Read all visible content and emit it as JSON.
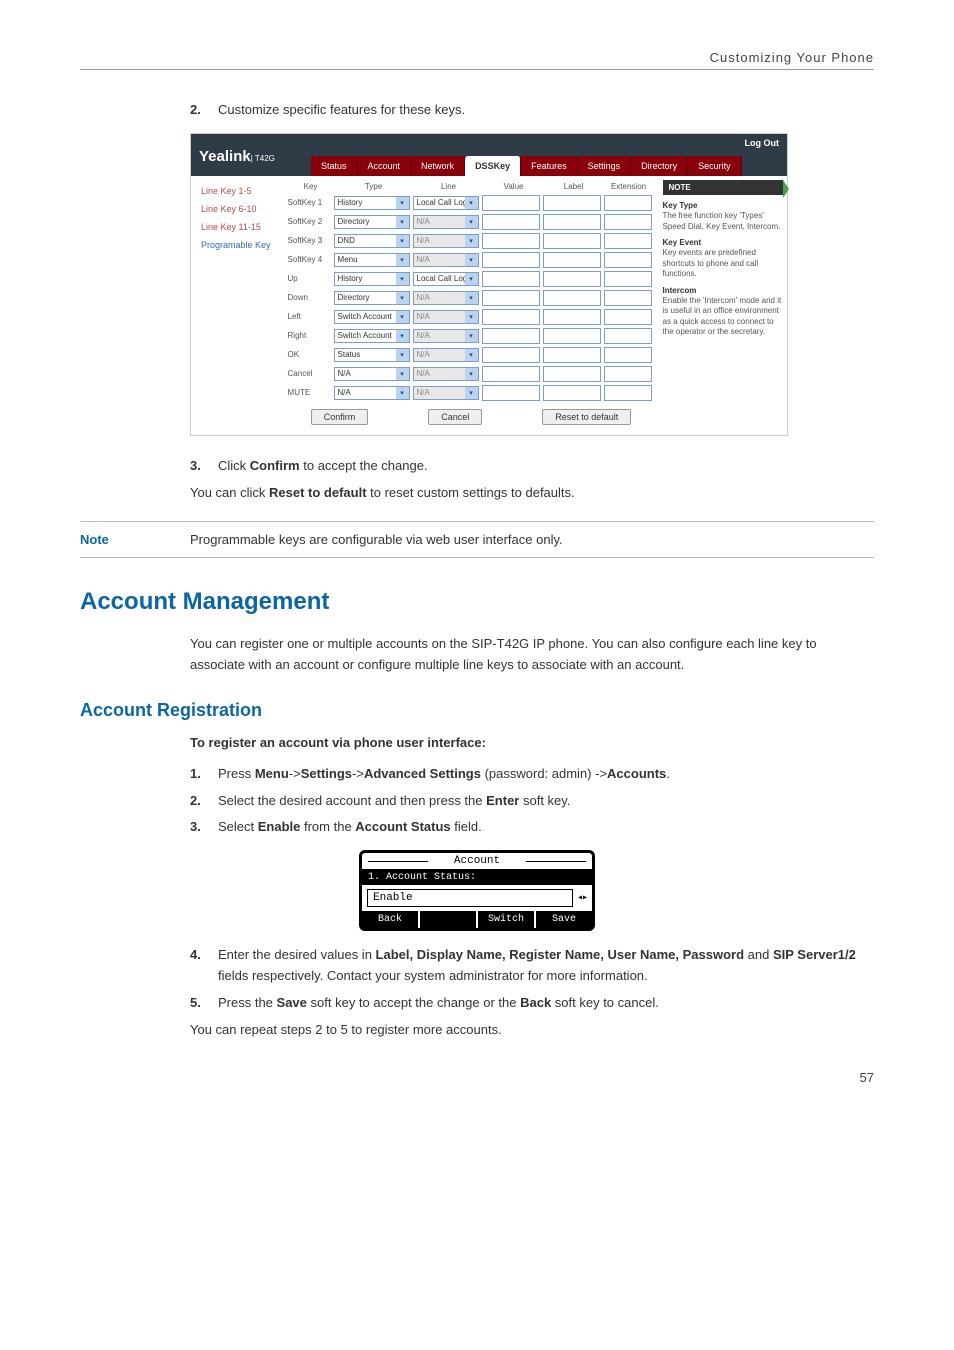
{
  "header": "Customizing Your Phone",
  "step2": {
    "num": "2.",
    "text": "Customize specific features for these keys."
  },
  "webui": {
    "logout": "Log Out",
    "brand": "Yealink",
    "brand_sub": "| T42G",
    "tabs": [
      "Status",
      "Account",
      "Network",
      "DSSKey",
      "Features",
      "Settings",
      "Directory",
      "Security"
    ],
    "active_tab": "DSSKey",
    "side": [
      "Line Key 1-5",
      "Line Key 6-10",
      "Line Key 11-15",
      "Programable Key"
    ],
    "side_active": "Programable Key",
    "cols": [
      "Key",
      "Type",
      "Line",
      "Value",
      "Label",
      "Extension"
    ],
    "rows": [
      {
        "key": "SoftKey 1",
        "type": "History",
        "line": "Local Call Log",
        "line_enabled": true
      },
      {
        "key": "SoftKey 2",
        "type": "Directory",
        "line": "N/A",
        "line_enabled": false
      },
      {
        "key": "SoftKey 3",
        "type": "DND",
        "line": "N/A",
        "line_enabled": false
      },
      {
        "key": "SoftKey 4",
        "type": "Menu",
        "line": "N/A",
        "line_enabled": false
      },
      {
        "key": "Up",
        "type": "History",
        "line": "Local Call Log",
        "line_enabled": true
      },
      {
        "key": "Down",
        "type": "Directory",
        "line": "N/A",
        "line_enabled": false
      },
      {
        "key": "Left",
        "type": "Switch Account",
        "line": "N/A",
        "line_enabled": false
      },
      {
        "key": "Right",
        "type": "Switch Account",
        "line": "N/A",
        "line_enabled": false
      },
      {
        "key": "OK",
        "type": "Status",
        "line": "N/A",
        "line_enabled": false
      },
      {
        "key": "Cancel",
        "type": "N/A",
        "line": "N/A",
        "line_enabled": false
      },
      {
        "key": "MUTE",
        "type": "N/A",
        "line": "N/A",
        "line_enabled": false
      }
    ],
    "buttons": {
      "confirm": "Confirm",
      "cancel": "Cancel",
      "reset": "Reset to default"
    },
    "note": {
      "head": "NOTE",
      "b1": {
        "title": "Key Type",
        "text": "The free function key 'Types' Speed Dial, Key Event, Intercom."
      },
      "b2": {
        "title": "Key Event",
        "text": "Key events are predefined shortcuts to phone and call functions."
      },
      "b3": {
        "title": "Intercom",
        "text": "Enable the 'Intercom' mode and it is useful in an office environment as a quick access to connect to the operator or the secretary."
      }
    }
  },
  "step3": {
    "num": "3.",
    "pre": "Click ",
    "bold": "Confirm",
    "post": " to accept the change."
  },
  "reset_line": {
    "pre": "You can click ",
    "bold": "Reset to default",
    "post": " to reset custom settings to defaults."
  },
  "note_row": {
    "label": "Note",
    "text": "Programmable keys are configurable via web user interface only."
  },
  "h1": "Account Management",
  "p1": "You can register one or multiple accounts on the SIP-T42G IP phone. You can also configure each line key to associate with an account or configure multiple line keys to associate with an account.",
  "h2": "Account Registration",
  "reg_intro": "To register an account via phone user interface:",
  "rstep1": {
    "num": "1.",
    "parts": [
      {
        "t": "Press ",
        "b": false
      },
      {
        "t": "Menu",
        "b": true
      },
      {
        "t": "->",
        "b": false
      },
      {
        "t": "Settings",
        "b": true
      },
      {
        "t": "->",
        "b": false
      },
      {
        "t": "Advanced Settings",
        "b": true
      },
      {
        "t": " (password: admin) ->",
        "b": false
      },
      {
        "t": "Accounts",
        "b": true
      },
      {
        "t": ".",
        "b": false
      }
    ]
  },
  "rstep2": {
    "num": "2.",
    "pre": "Select the desired account and then press the ",
    "bold": "Enter",
    "post": " soft key."
  },
  "rstep3": {
    "num": "3.",
    "pre": "Select ",
    "bold1": "Enable",
    "mid": " from the ",
    "bold2": "Account Status",
    "post": " field."
  },
  "lcd": {
    "title": "Account",
    "row1": "1. Account Status:",
    "value": "Enable",
    "softkeys": [
      "Back",
      "",
      "Switch",
      "Save"
    ]
  },
  "rstep4": {
    "num": "4.",
    "pre": "Enter the desired values in ",
    "bold1": "Label, Display Name, Register Name, User Name, Password",
    "mid": " and ",
    "bold2": "SIP Server1/2",
    "post": " fields respectively. Contact your system administrator for more information."
  },
  "rstep5": {
    "num": "5.",
    "pre": "Press the ",
    "bold1": "Save",
    "mid": " soft key to accept the change or the ",
    "bold2": "Back",
    "post": " soft key to cancel."
  },
  "repeat": "You can repeat steps 2 to 5 to register more accounts.",
  "pagenum": "57"
}
